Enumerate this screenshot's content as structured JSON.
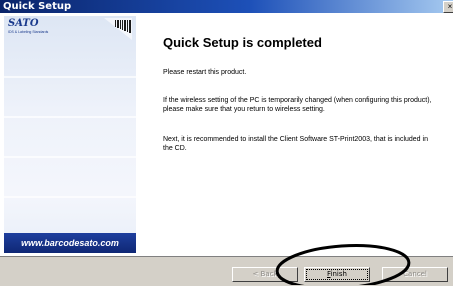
{
  "window": {
    "title": "Quick Setup",
    "close_glyph": "×"
  },
  "sidepanel": {
    "logo": "SATO",
    "logo_tagline": "IDS & Labeling Standards",
    "url": "www.barcodesato.com"
  },
  "content": {
    "heading": "Quick Setup is completed",
    "paragraphs": [
      "Please restart this product.",
      "If the wireless setting of the PC is temporarily changed (when configuring this product), please make sure that you return to wireless setting.",
      "Next, it is recommended to install the Client Software ST-Print2003, that is included in the CD."
    ]
  },
  "buttons": {
    "back": {
      "label": "< Back",
      "enabled": false
    },
    "finish": {
      "label": "Finish",
      "mnemonic": "F",
      "rest": "inish",
      "enabled": true
    },
    "cancel": {
      "label": "Cancel",
      "enabled": false
    }
  },
  "colors": {
    "title_bar": "#0a246a",
    "url_band": "#1e3f9e",
    "dialog_face": "#d4d0c8",
    "annotation_ink": "#000000"
  },
  "icons": [
    "close-icon",
    "barcode-icon",
    "annotation-ellipse"
  ]
}
